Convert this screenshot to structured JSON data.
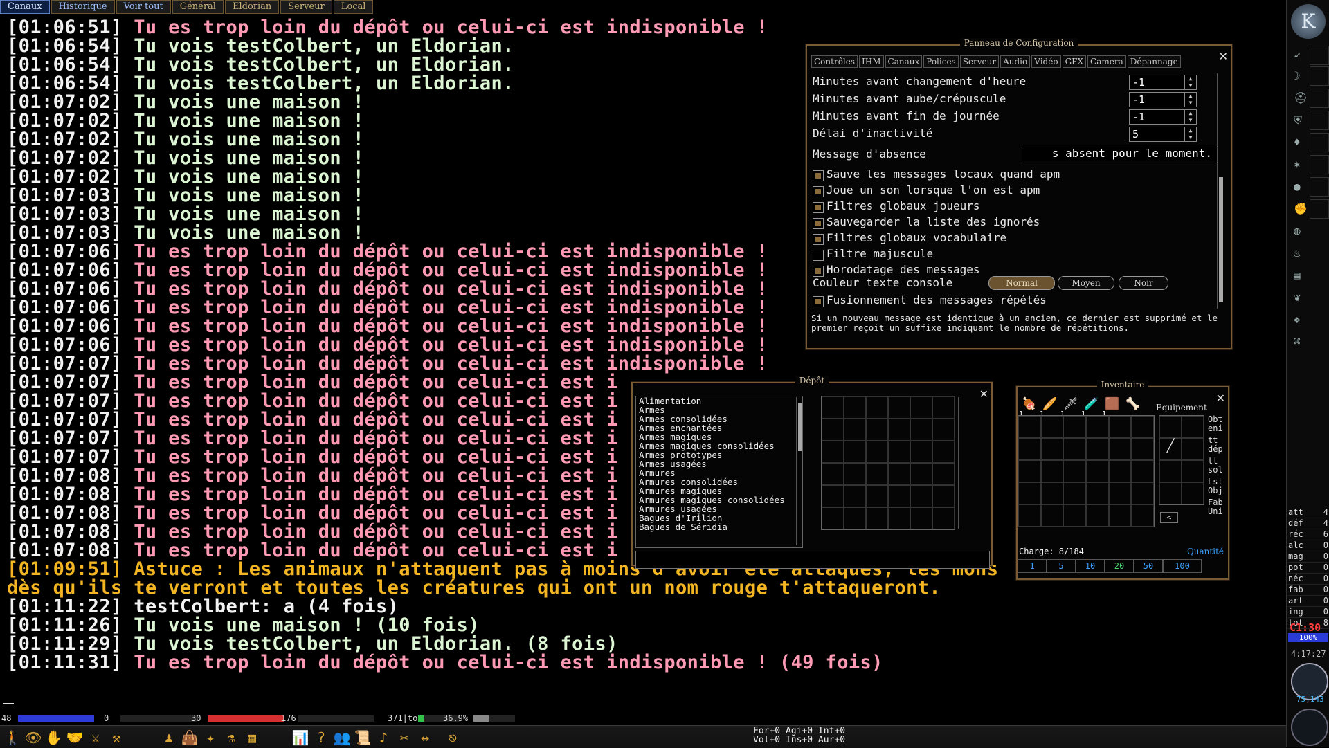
{
  "tabs": [
    {
      "label": "Canaux",
      "state": "active"
    },
    {
      "label": "Historique",
      "state": "blue"
    },
    {
      "label": "Voir tout",
      "state": "blue"
    },
    {
      "label": "Général",
      "state": ""
    },
    {
      "label": "Eldorian",
      "state": ""
    },
    {
      "label": "Serveur",
      "state": ""
    },
    {
      "label": "Local",
      "state": ""
    }
  ],
  "console": [
    {
      "ts": "[01:06:51]",
      "msg": " Tu es trop loin du dépôt ou celui-ci est indisponible !",
      "color": "pink"
    },
    {
      "ts": "[01:06:54]",
      "msg": " Tu vois testColbert, un Eldorian.",
      "color": "green"
    },
    {
      "ts": "[01:06:54]",
      "msg": " Tu vois testColbert, un Eldorian.",
      "color": "green"
    },
    {
      "ts": "[01:06:54]",
      "msg": " Tu vois testColbert, un Eldorian.",
      "color": "green"
    },
    {
      "ts": "[01:07:02]",
      "msg": " Tu vois une maison !",
      "color": "green"
    },
    {
      "ts": "[01:07:02]",
      "msg": " Tu vois une maison !",
      "color": "green"
    },
    {
      "ts": "[01:07:02]",
      "msg": " Tu vois une maison !",
      "color": "green"
    },
    {
      "ts": "[01:07:02]",
      "msg": " Tu vois une maison !",
      "color": "green"
    },
    {
      "ts": "[01:07:02]",
      "msg": " Tu vois une maison !",
      "color": "green"
    },
    {
      "ts": "[01:07:03]",
      "msg": " Tu vois une maison !",
      "color": "green"
    },
    {
      "ts": "[01:07:03]",
      "msg": " Tu vois une maison !",
      "color": "green"
    },
    {
      "ts": "[01:07:03]",
      "msg": " Tu vois une maison !",
      "color": "green"
    },
    {
      "ts": "[01:07:06]",
      "msg": " Tu es trop loin du dépôt ou celui-ci est indisponible !",
      "color": "pink"
    },
    {
      "ts": "[01:07:06]",
      "msg": " Tu es trop loin du dépôt ou celui-ci est indisponible !",
      "color": "pink"
    },
    {
      "ts": "[01:07:06]",
      "msg": " Tu es trop loin du dépôt ou celui-ci est indisponible !",
      "color": "pink"
    },
    {
      "ts": "[01:07:06]",
      "msg": " Tu es trop loin du dépôt ou celui-ci est indisponible !",
      "color": "pink"
    },
    {
      "ts": "[01:07:06]",
      "msg": " Tu es trop loin du dépôt ou celui-ci est indisponible !",
      "color": "pink"
    },
    {
      "ts": "[01:07:06]",
      "msg": " Tu es trop loin du dépôt ou celui-ci est indisponible !",
      "color": "pink"
    },
    {
      "ts": "[01:07:07]",
      "msg": " Tu es trop loin du dépôt ou celui-ci est indisponible !",
      "color": "pink"
    },
    {
      "ts": "[01:07:07]",
      "msg": " Tu es trop loin du dépôt ou celui-ci est i",
      "color": "pink"
    },
    {
      "ts": "[01:07:07]",
      "msg": " Tu es trop loin du dépôt ou celui-ci est i",
      "color": "pink"
    },
    {
      "ts": "[01:07:07]",
      "msg": " Tu es trop loin du dépôt ou celui-ci est i",
      "color": "pink"
    },
    {
      "ts": "[01:07:07]",
      "msg": " Tu es trop loin du dépôt ou celui-ci est i",
      "color": "pink"
    },
    {
      "ts": "[01:07:07]",
      "msg": " Tu es trop loin du dépôt ou celui-ci est i",
      "color": "pink"
    },
    {
      "ts": "[01:07:08]",
      "msg": " Tu es trop loin du dépôt ou celui-ci est i",
      "color": "pink"
    },
    {
      "ts": "[01:07:08]",
      "msg": " Tu es trop loin du dépôt ou celui-ci est i",
      "color": "pink"
    },
    {
      "ts": "[01:07:08]",
      "msg": " Tu es trop loin du dépôt ou celui-ci est i",
      "color": "pink"
    },
    {
      "ts": "[01:07:08]",
      "msg": " Tu es trop loin du dépôt ou celui-ci est i",
      "color": "pink"
    },
    {
      "ts": "[01:07:08]",
      "msg": " Tu es trop loin du dépôt ou celui-ci est i",
      "color": "pink"
    },
    {
      "ts": "[01:09:51]",
      "msg": " Astuce : Les animaux n'attaquent pas à moins d'avoir été attaqués, les mons",
      "color": "yellow"
    },
    {
      "ts": "",
      "msg": "dès qu'ils te verront et toutes les créatures qui ont un nom rouge t'attaqueront.",
      "color": "yellow"
    },
    {
      "ts": "[01:11:22]",
      "msg": " testColbert: a (4 fois)",
      "color": "white"
    },
    {
      "ts": "[01:11:26]",
      "msg": " Tu vois une maison ! (10 fois)",
      "color": "green"
    },
    {
      "ts": "[01:11:29]",
      "msg": " Tu vois testColbert, un Eldorian. (8 fois)",
      "color": "green"
    },
    {
      "ts": "[01:11:31]",
      "msg": " Tu es trop loin du dépôt ou celui-ci est indisponible ! (49 fois)",
      "color": "pink"
    }
  ],
  "config": {
    "title": "Panneau de Configuration",
    "tabs": [
      "Contrôles",
      "IHM",
      "Canaux",
      "Polices",
      "Serveur",
      "Audio",
      "Vidéo",
      "GFX",
      "Camera",
      "Dépannage"
    ],
    "spinners": [
      {
        "label": "Minutes avant changement d'heure",
        "value": "-1"
      },
      {
        "label": "Minutes avant aube/crépuscule",
        "value": "-1"
      },
      {
        "label": "Minutes avant fin de journée",
        "value": "-1"
      },
      {
        "label": "Délai d'inactivité",
        "value": "5"
      }
    ],
    "absence_label": "Message d'absence",
    "absence_value": "s absent pour le moment.",
    "checkboxes": [
      {
        "label": "Sauve les messages locaux quand apm",
        "checked": true
      },
      {
        "label": "Joue un son lorsque l'on est apm",
        "checked": true
      },
      {
        "label": "Filtres globaux joueurs",
        "checked": true
      },
      {
        "label": "Sauvegarder la liste des ignorés",
        "checked": true
      },
      {
        "label": "Filtres globaux vocabulaire",
        "checked": true
      },
      {
        "label": "Filtre majuscule",
        "checked": false
      },
      {
        "label": "Horodatage des messages",
        "checked": true
      }
    ],
    "color_label": "Couleur texte console",
    "color_options": [
      "Normal",
      "Moyen",
      "Noir"
    ],
    "merge_label": "Fusionnement des messages répétés",
    "merge_checked": true,
    "description": "Si un nouveau message est identique à un ancien, ce dernier est supprimé et le premier reçoit un suffixe indiquant le nombre de répétitions."
  },
  "depot": {
    "title": "Dépôt",
    "categories": [
      "Alimentation",
      "Armes",
      "Armes consolidées",
      "Armes enchantées",
      "Armes magiques",
      "Armes magiques consolidées",
      "Armes prototypes",
      "Armes usagées",
      "Armures",
      "Armures consolidées",
      "Armures magiques",
      "Armures magiques consolidées",
      "Armures usagées",
      "Bagues d'Irilion",
      "Bagues de Séridia"
    ]
  },
  "inventory": {
    "title": "Inventaire",
    "quick_slots": [
      {
        "icon": "meat-icon",
        "glyph": "🍖",
        "count": "1"
      },
      {
        "icon": "bread-icon",
        "glyph": "🥖",
        "count": "1"
      },
      {
        "icon": "dagger-icon",
        "glyph": "🗡",
        "count": "1"
      },
      {
        "icon": "potion-icon",
        "glyph": "🧪",
        "count": "1"
      },
      {
        "icon": "leather-icon",
        "glyph": "🟫",
        "count": "1"
      },
      {
        "icon": "pelt-icon",
        "glyph": "🦴",
        "count": ""
      }
    ],
    "equipment_label": "Equipement",
    "side_buttons": [
      "Obt eni",
      "tt dép",
      "tt sol",
      "Lst Obj",
      "Fab Uni"
    ],
    "charge": "Charge: 8/184",
    "quantity_label": "Quantité",
    "quantities": [
      "1",
      "5",
      "10",
      "20",
      "50",
      "100"
    ],
    "selected_quantity": "20"
  },
  "sidebar": {
    "logo": "K",
    "stats": [
      {
        "k": "att",
        "v": "4"
      },
      {
        "k": "déf",
        "v": "4"
      },
      {
        "k": "réc",
        "v": "6"
      },
      {
        "k": "alc",
        "v": "0"
      },
      {
        "k": "mag",
        "v": "0"
      },
      {
        "k": "pot",
        "v": "0"
      },
      {
        "k": "néc",
        "v": "0"
      },
      {
        "k": "fab",
        "v": "0"
      },
      {
        "k": "art",
        "v": "0"
      },
      {
        "k": "ing",
        "v": "0"
      },
      {
        "k": "tot",
        "v": "8"
      }
    ],
    "timer": "C1:30",
    "percent": "100%",
    "clock": "4:17:27",
    "coords": "75,143"
  },
  "bottom": {
    "bars": [
      {
        "label": "48",
        "value": 48,
        "max": 48,
        "color": "#2f3bd6"
      },
      {
        "label": "0",
        "value": 0,
        "max": 100,
        "color": "#2f3bd6"
      },
      {
        "label": "30",
        "value": 30,
        "max": 30,
        "color": "#d62f2f"
      },
      {
        "label": "176",
        "value": 0,
        "max": 100,
        "color": "#888"
      },
      {
        "label": "371|tot",
        "value": 0.15,
        "max": 1,
        "color": "#32c14a"
      },
      {
        "label": "36.9%",
        "value": 0.369,
        "max": 1,
        "color": "#888"
      }
    ],
    "attributes_line1": "For+0 Agi+0 Int+0",
    "attributes_line2": "Vol+0 Ins+0 Aur+0"
  }
}
